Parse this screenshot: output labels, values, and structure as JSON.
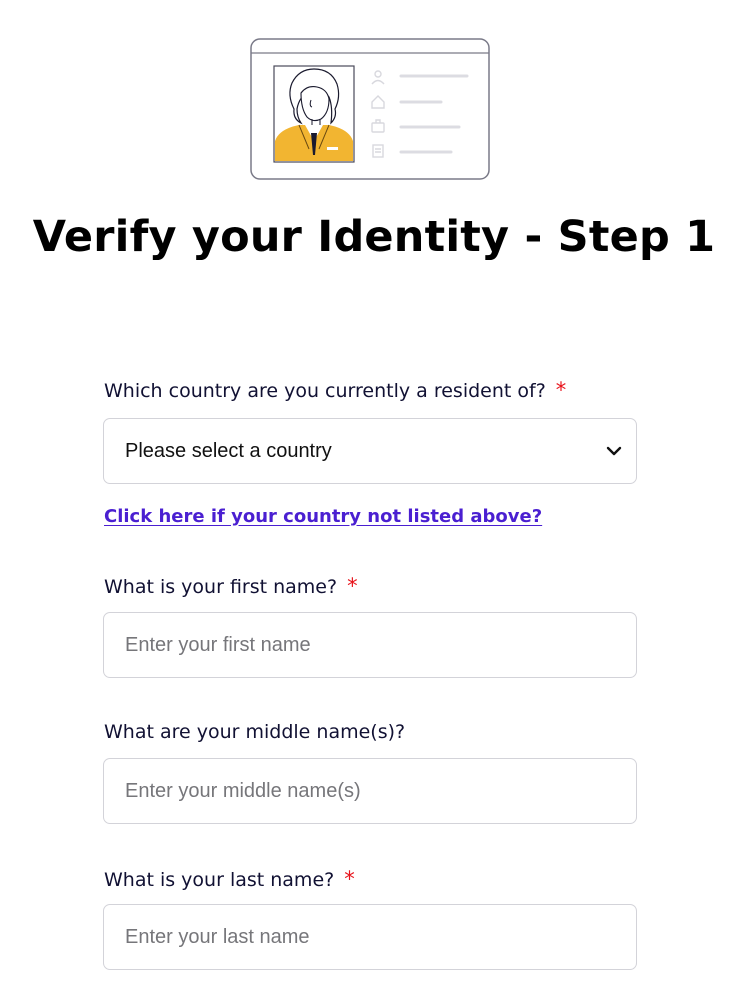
{
  "page": {
    "title": "Verify your Identity - Step 1"
  },
  "country": {
    "label": "Which country are you currently a resident of?",
    "required_marker": "*",
    "selected_value": "Please select a country",
    "not_listed_link": "Click here if your country not listed above?"
  },
  "first_name": {
    "label": "What is your first name?",
    "required_marker": "*",
    "placeholder": "Enter your first name",
    "value": ""
  },
  "middle_name": {
    "label": "What are your middle name(s)?",
    "placeholder": "Enter your middle name(s)",
    "value": ""
  },
  "last_name": {
    "label": "What is your last name?",
    "required_marker": "*",
    "placeholder": "Enter your last name",
    "value": ""
  },
  "icons": {
    "illustration": "id-card-illustration",
    "select_arrow": "chevron-down-icon"
  },
  "colors": {
    "required": "#e8141c",
    "link": "#4a1fd1",
    "illustration_accent": "#f2b531",
    "border": "#d3d3d9"
  }
}
